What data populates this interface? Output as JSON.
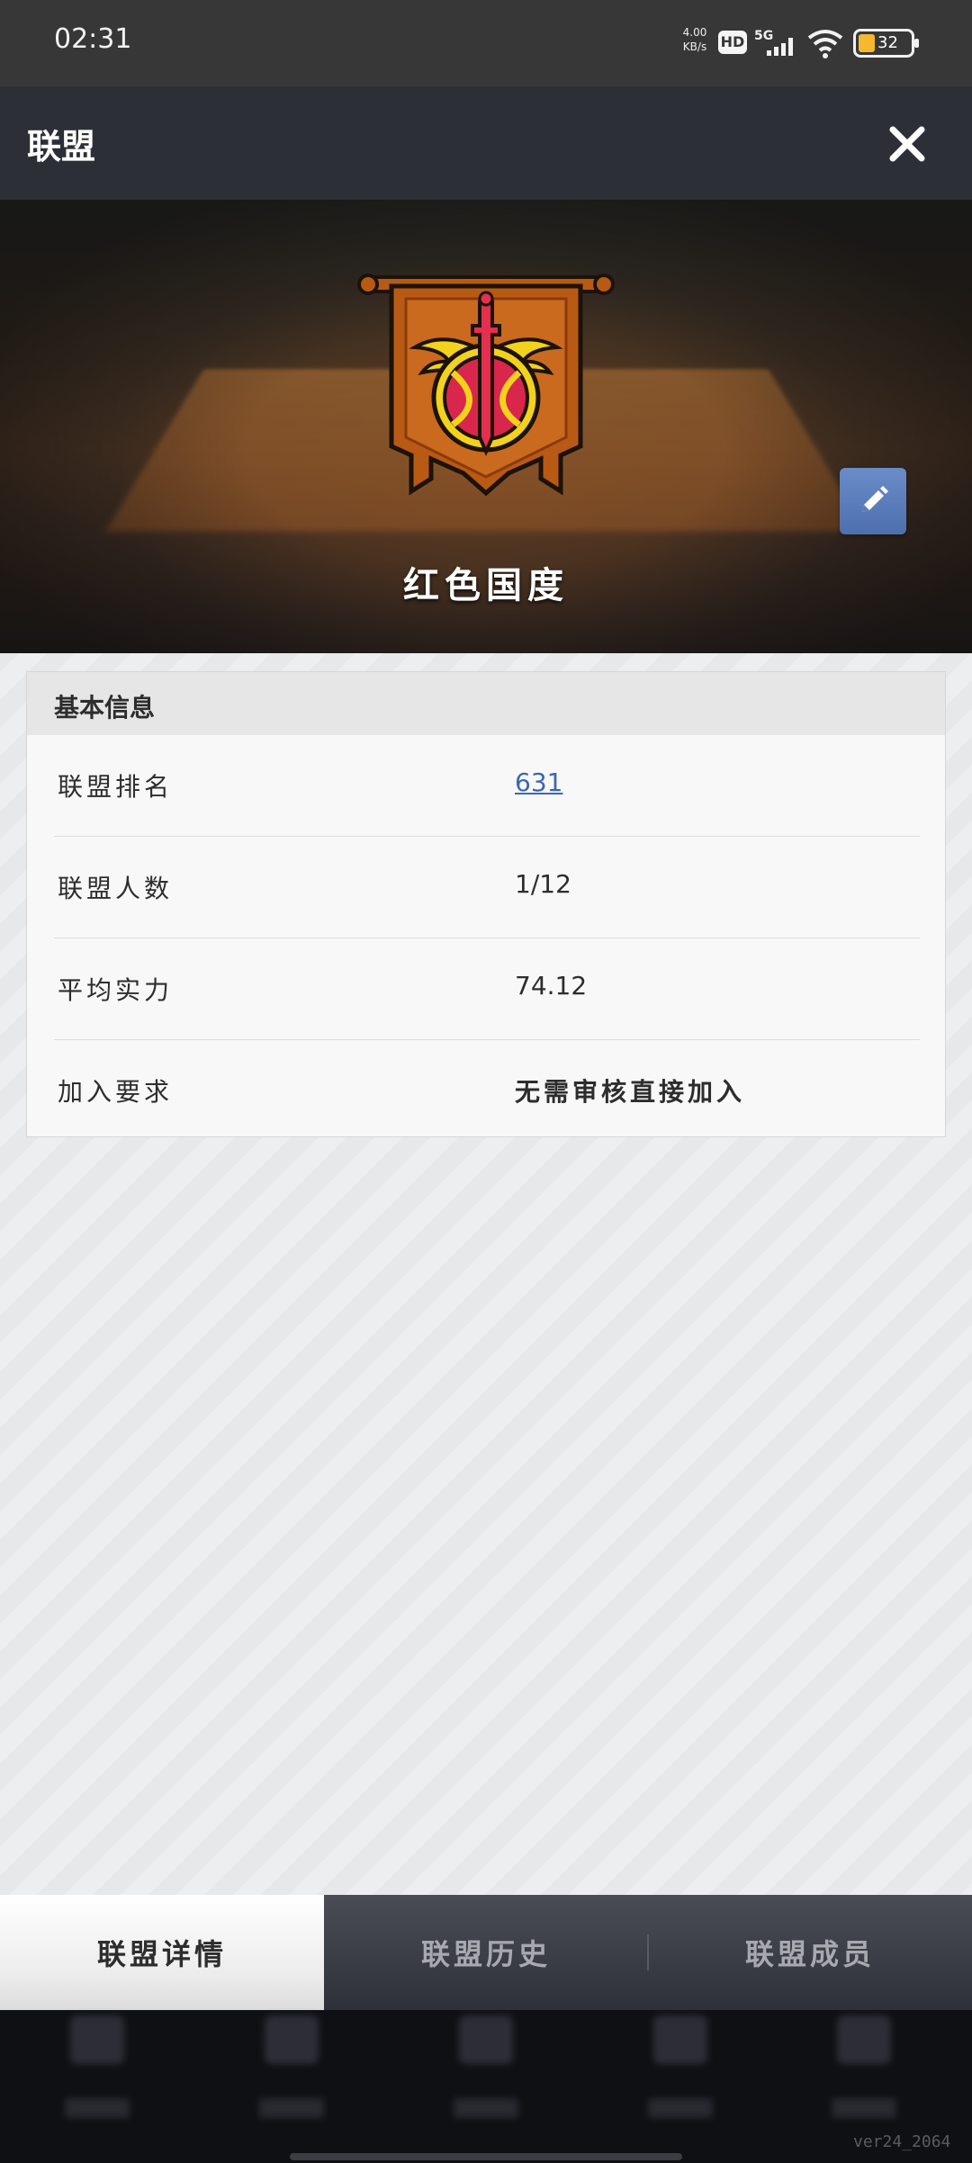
{
  "status_bar": {
    "time": "02:31",
    "net_speed_value": "4.00",
    "net_speed_unit": "KB/s",
    "hd_label": "HD",
    "network": "5G",
    "battery_level": "32"
  },
  "header": {
    "title": "联盟",
    "close_icon": "close-icon"
  },
  "banner": {
    "team_name": "红色国度",
    "edit_icon": "pencil-icon"
  },
  "info_card": {
    "title": "基本信息",
    "rows": [
      {
        "label": "联盟排名",
        "value": "631"
      },
      {
        "label": "联盟人数",
        "value": "1/12"
      },
      {
        "label": "平均实力",
        "value": "74.12"
      },
      {
        "label": "加入要求",
        "value": "无需审核直接加入"
      }
    ]
  },
  "tabs": [
    {
      "label": "联盟详情",
      "active": true
    },
    {
      "label": "联盟历史",
      "active": false
    },
    {
      "label": "联盟成员",
      "active": false
    }
  ],
  "footer": {
    "version": "ver24_2064"
  },
  "colors": {
    "header_bg": "#2c2f36",
    "link": "#3a67b0",
    "edit_button": "#5a7bbb",
    "logo_orange": "#b85a14",
    "logo_red": "#d8264c",
    "logo_yellow": "#f2d21c"
  }
}
